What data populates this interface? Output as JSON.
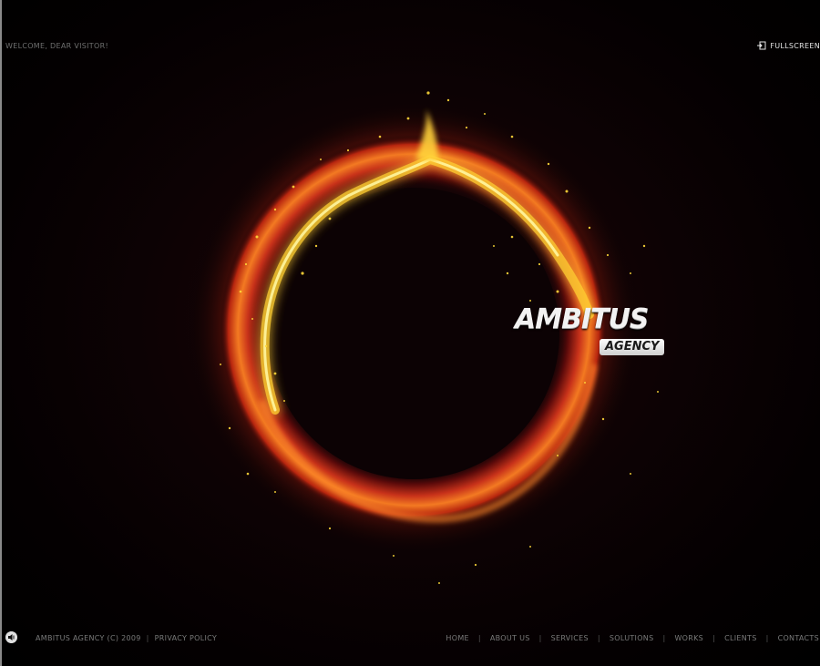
{
  "header": {
    "welcome_text": "WELCOME, DEAR VISITOR!",
    "fullscreen_label": "FULLSCREEN"
  },
  "logo": {
    "title": "AMBITUS",
    "subtitle": "AGENCY"
  },
  "footer": {
    "copyright": "AMBITUS AGENCY (C) 2009",
    "separator": "|",
    "privacy_label": "PRIVACY POLICY",
    "nav": [
      {
        "label": "HOME"
      },
      {
        "label": "ABOUT US"
      },
      {
        "label": "SERVICES"
      },
      {
        "label": "SOLUTIONS"
      },
      {
        "label": "WORKS"
      },
      {
        "label": "CLIENTS"
      },
      {
        "label": "CONTACTS"
      }
    ]
  },
  "colors": {
    "background": "#0d0204",
    "ring_outer": "#e8541c",
    "ring_glow": "#ffd23a",
    "text_dim": "#7a7a7a"
  },
  "icons": {
    "fullscreen": "fullscreen-icon",
    "sound": "sound-icon"
  }
}
